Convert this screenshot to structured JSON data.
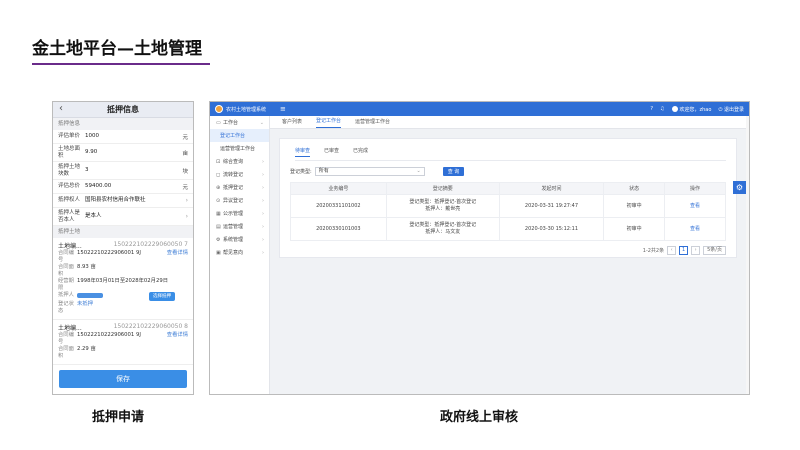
{
  "slide": {
    "title": "金土地平台—土地管理",
    "caption_left": "抵押申请",
    "caption_right": "政府线上审核"
  },
  "phone": {
    "back": "‹",
    "title": "抵押信息",
    "section_pledge": "抵押信息",
    "rows": [
      {
        "label": "评估单价",
        "value": "1000",
        "unit": "元"
      },
      {
        "label": "土地总面积",
        "value": "9.90",
        "unit": "亩"
      },
      {
        "label": "抵押土地块数",
        "value": "3",
        "unit": "块"
      },
      {
        "label": "评估总价",
        "value": "59400.00",
        "unit": "元"
      }
    ],
    "rows2": [
      {
        "label": "抵押权人",
        "value": "国阳县农村信用合作联社"
      },
      {
        "label": "抵押人是否本人",
        "value": "是本人"
      }
    ],
    "section_land": "抵押土地",
    "land_blocks": [
      {
        "title": "土地编...",
        "code": "150222102229060050 7",
        "contract_label": "合同编号",
        "contract": "15022210222906001 9J",
        "view": "查看详情",
        "area_label": "合同面积",
        "area": "8.93 亩",
        "period_label": "经营期限",
        "period": "1998年03月01日至2028年02月29日",
        "mortgagor_label": "抵押人",
        "select_btn": "选择抵押",
        "status_label": "登记状态",
        "status": "未抵押"
      },
      {
        "title": "土地编...",
        "code": "150222102229060050 8",
        "contract_label": "合同编号",
        "contract": "15022210222906001 9J",
        "view": "查看详情",
        "area_label": "合同面积",
        "area": "2.29 亩"
      }
    ],
    "save": "保存"
  },
  "admin": {
    "app_name": "农村土地管理系统",
    "menu_icon": "≡",
    "welcome": "欢迎您，zhao",
    "logout": "退出登录",
    "sidebar": [
      {
        "icon": "▭",
        "label": "工作台",
        "chev": "⌄",
        "sub": false,
        "active": false
      },
      {
        "icon": "",
        "label": "登记工作台",
        "chev": "",
        "sub": true,
        "active": true
      },
      {
        "icon": "",
        "label": "运营管理工作台",
        "chev": "",
        "sub": true,
        "active": false
      },
      {
        "icon": "⊡",
        "label": "综合查询",
        "chev": "›",
        "sub": false,
        "active": false
      },
      {
        "icon": "◻",
        "label": "流转登记",
        "chev": "›",
        "sub": false,
        "active": false
      },
      {
        "icon": "⊕",
        "label": "抵押登记",
        "chev": "›",
        "sub": false,
        "active": false
      },
      {
        "icon": "⊙",
        "label": "异议登记",
        "chev": "›",
        "sub": false,
        "active": false
      },
      {
        "icon": "▦",
        "label": "公示管理",
        "chev": "›",
        "sub": false,
        "active": false
      },
      {
        "icon": "▤",
        "label": "运营管理",
        "chev": "›",
        "sub": false,
        "active": false
      },
      {
        "icon": "⚙",
        "label": "系统管理",
        "chev": "›",
        "sub": false,
        "active": false
      },
      {
        "icon": "▣",
        "label": "帮见意向",
        "chev": "›",
        "sub": false,
        "active": false
      }
    ],
    "top_tabs": [
      "客户列表",
      "登记工作台",
      "运营管理工作台"
    ],
    "sub_tabs": [
      "待审查",
      "已审查",
      "已完成"
    ],
    "filter_label": "登记类型:",
    "filter_value": "所有",
    "query_button": "查 询",
    "table": {
      "headers": [
        "业务编号",
        "登记摘要",
        "发起时间",
        "状态",
        "操作"
      ],
      "rows": [
        {
          "id": "20200331101002",
          "summary1": "登记类型：抵押登记-首次登记",
          "summary2": "抵押人：戴世亮",
          "time": "2020-03-31 19:27:47",
          "status": "初审中",
          "action": "查看"
        },
        {
          "id": "20200330101003",
          "summary1": "登记类型：抵押登记-首次登记",
          "summary2": "抵押人：马文友",
          "time": "2020-03-30 15:12:11",
          "status": "初审中",
          "action": "查看"
        }
      ]
    },
    "pager": {
      "total": "1-2共2条",
      "prev": "‹",
      "page": "1",
      "next": "›",
      "size": "5条/页"
    }
  }
}
